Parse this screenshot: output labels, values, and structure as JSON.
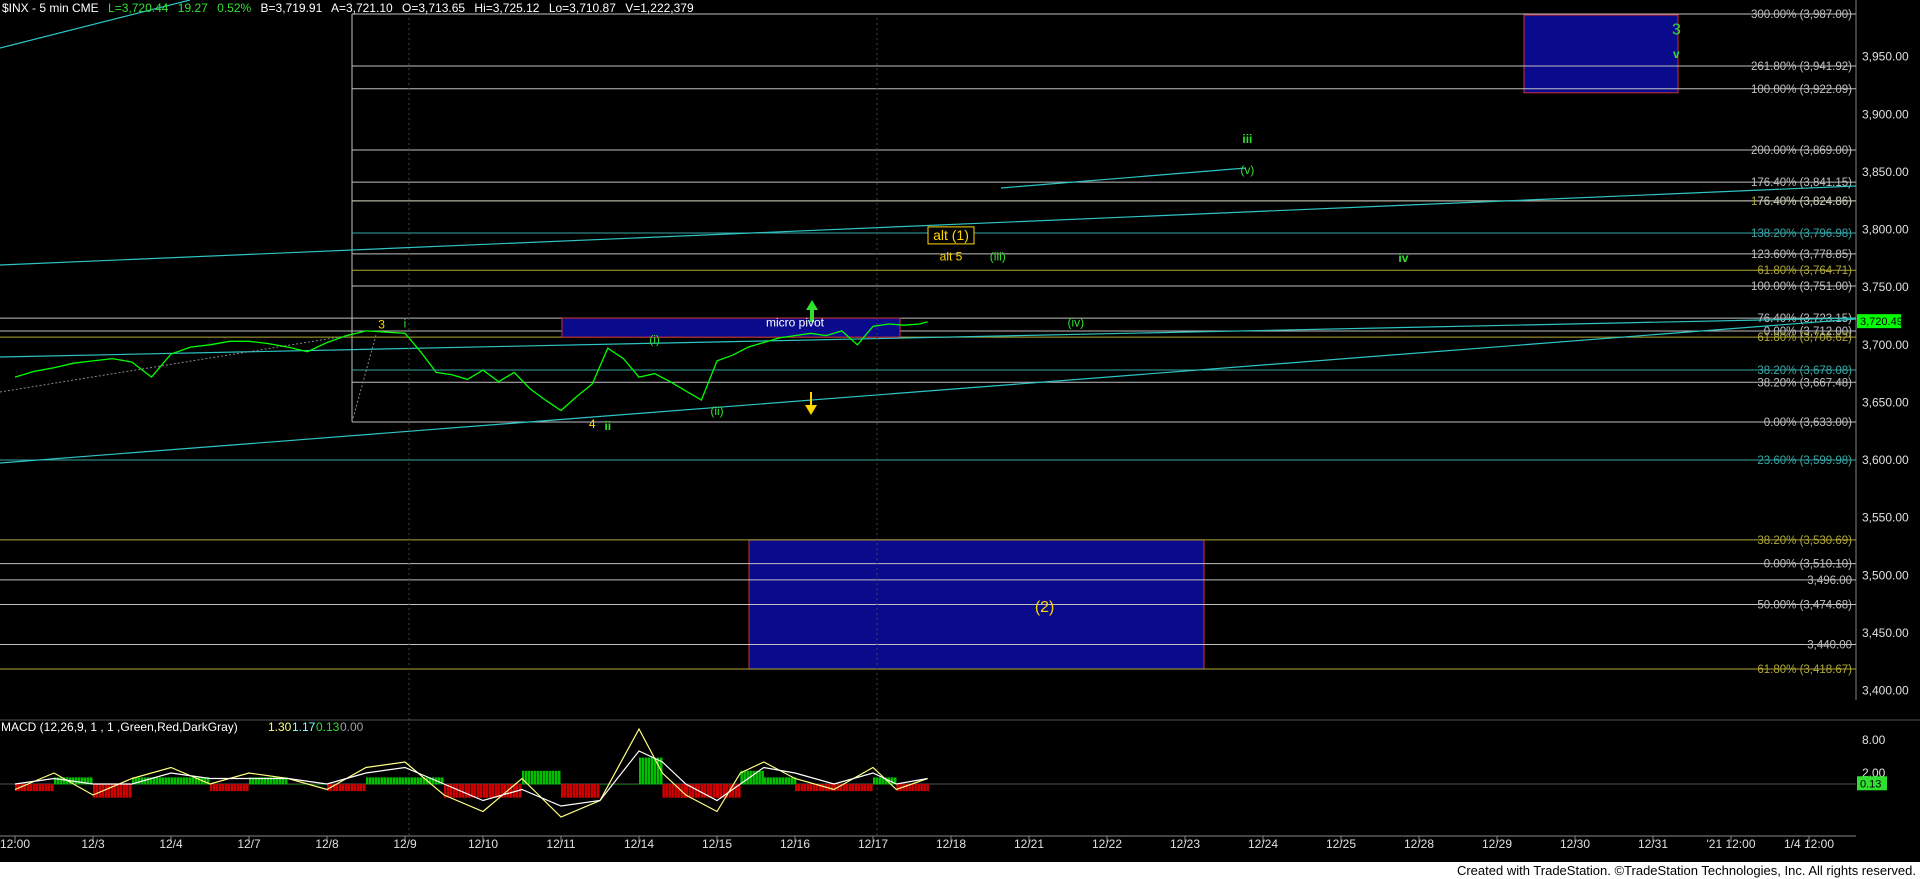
{
  "header": {
    "symbol": "$INX - 5 min CME",
    "last": "L=3,720.44",
    "change": "19.27",
    "pct": "0.52%",
    "bid": "B=3,719.91",
    "ask": "A=3,721.10",
    "open": "O=3,713.65",
    "high": "Hi=3,725.12",
    "low": "Lo=3,710.87",
    "volume": "V=1,222,379"
  },
  "colors": {
    "background": "#000000",
    "price": "#00ff00",
    "channel": "#2ec4c4",
    "fib_gray": "#c0c0c0",
    "fib_teal": "#38a8a8",
    "fib_olive": "#b0a838",
    "target_box": "#0a0a8c",
    "target_border": "#d03030",
    "yellow": "#ffd700",
    "green_label": "#30e030"
  },
  "footer": {
    "text": "Created with TradeStation. ©TradeStation Technologies, Inc. All rights reserved."
  },
  "chart_data": {
    "type": "line",
    "title": "$INX - 5 min CME",
    "xlabel": "",
    "ylabel": "",
    "ylim": [
      3370,
      3995
    ],
    "y_ticks": [
      "3,950.00",
      "3,900.00",
      "3,850.00",
      "3,800.00",
      "3,750.00",
      "3,700.00",
      "3,650.00",
      "3,600.00",
      "3,550.00",
      "3,500.00",
      "3,450.00",
      "3,400.00"
    ],
    "x_ticks": [
      "12:00",
      "12/3",
      "12/4",
      "12/7",
      "12/8",
      "12/9",
      "12/10",
      "12/11",
      "12/14",
      "12/15",
      "12/16",
      "12/17",
      "12/18",
      "12/21",
      "12/22",
      "12/23",
      "12/24",
      "12/25",
      "12/28",
      "12/29",
      "12/30",
      "12/31",
      "'21 12:00",
      "1/4 12:00"
    ],
    "last_price": "3,720.49",
    "price_series": {
      "name": "$INX",
      "x_index": [
        0,
        0.25,
        0.5,
        0.75,
        1.0,
        1.25,
        1.5,
        1.75,
        2.0,
        2.25,
        2.5,
        2.75,
        3.0,
        3.25,
        3.5,
        3.75,
        4.0,
        4.25,
        4.5,
        4.75,
        5.0,
        5.2,
        5.4,
        5.6,
        5.8,
        6.0,
        6.2,
        6.4,
        6.6,
        6.8,
        7.0,
        7.2,
        7.4,
        7.6,
        7.8,
        8.0,
        8.2,
        8.4,
        8.6,
        8.8,
        9.0,
        9.2,
        9.4,
        9.6,
        9.8,
        10.0,
        10.2,
        10.4,
        10.6,
        10.8,
        11.0,
        11.2,
        11.4,
        11.6,
        11.7
      ],
      "values": [
        3672,
        3677,
        3680,
        3684,
        3686,
        3688,
        3685,
        3672,
        3692,
        3698,
        3700,
        3703,
        3703,
        3701,
        3698,
        3694,
        3702,
        3708,
        3712,
        3711,
        3710,
        3694,
        3676,
        3674,
        3670,
        3678,
        3668,
        3676,
        3662,
        3652,
        3643,
        3655,
        3666,
        3697,
        3688,
        3672,
        3675,
        3668,
        3660,
        3652,
        3686,
        3691,
        3698,
        3702,
        3706,
        3708,
        3710,
        3708,
        3712,
        3700,
        3716,
        3718,
        3717,
        3718,
        3720
      ]
    },
    "fib_levels": [
      {
        "label": "300.00% (3,987.00)",
        "value": 3987,
        "color": "#c0c0c0"
      },
      {
        "label": "261.80% (3,941.92)",
        "value": 3941.92,
        "color": "#c0c0c0"
      },
      {
        "label": "100.00% (3,922.09)",
        "value": 3922.09,
        "color": "#c0c0c0"
      },
      {
        "label": "200.00% (3,869.00)",
        "value": 3869,
        "color": "#c0c0c0"
      },
      {
        "label": "176.40% (3,841.15)",
        "value": 3841.15,
        "color": "#c0c0c0"
      },
      {
        "label": "176.40% (3,824.86)",
        "value": 3824.86,
        "color": "#b0a838"
      },
      {
        "label": "76.40% (3,824.86)",
        "value": 3824.86,
        "color": "#c0c0c0"
      },
      {
        "label": "138.20% (3,796.98)",
        "value": 3796.98,
        "color": "#38a8a8"
      },
      {
        "label": "123.60% (3,778.85)",
        "value": 3778.85,
        "color": "#c0c0c0"
      },
      {
        "label": "61.80% (3,764.71)",
        "value": 3764.71,
        "color": "#b0a838"
      },
      {
        "label": "100.00% (3,751.00)",
        "value": 3751,
        "color": "#c0c0c0"
      },
      {
        "label": "76.40% (3,723.15)",
        "value": 3723.15,
        "color": "#c0c0c0"
      },
      {
        "label": "0.00% (3,712.00)",
        "value": 3712,
        "color": "#c0c0c0"
      },
      {
        "label": "61.80% (3,706.62)",
        "value": 3706.62,
        "color": "#b0a838"
      },
      {
        "label": "38.20% (3,678.08)",
        "value": 3678.08,
        "color": "#38a8a8"
      },
      {
        "label": "38.20% (3,667.48)",
        "value": 3667.48,
        "color": "#c0c0c0"
      },
      {
        "label": "0.00% (3,633.00)",
        "value": 3633,
        "color": "#c0c0c0"
      },
      {
        "label": "23.60% (3,599.98)",
        "value": 3599.98,
        "color": "#38a8a8"
      },
      {
        "label": "38.20% (3,530.69)",
        "value": 3530.69,
        "color": "#b0a838"
      },
      {
        "label": "0.00% (3,510.10)",
        "value": 3510.1,
        "color": "#c0c0c0"
      },
      {
        "label": "3,496.00",
        "value": 3496,
        "color": "#c0c0c0"
      },
      {
        "label": "50.00% (3,474.68)",
        "value": 3474.68,
        "color": "#c0c0c0"
      },
      {
        "label": "3,440.00",
        "value": 3440,
        "color": "#c0c0c0"
      },
      {
        "label": "61.80% (3,418.67)",
        "value": 3418.67,
        "color": "#b0a838"
      }
    ],
    "wave_labels": [
      {
        "text": "3",
        "x_index": 4.7,
        "value": 3714,
        "color": "#ffd700"
      },
      {
        "text": "i",
        "x_index": 5.0,
        "value": 3715,
        "color": "#30e030"
      },
      {
        "text": "4",
        "x_index": 7.4,
        "value": 3628,
        "color": "#ffd700"
      },
      {
        "text": "ii",
        "x_index": 7.6,
        "value": 3626,
        "color": "#30e030"
      },
      {
        "text": "(i)",
        "x_index": 8.2,
        "value": 3701,
        "color": "#30e030"
      },
      {
        "text": "(ii)",
        "x_index": 9.0,
        "value": 3639,
        "color": "#30e030"
      },
      {
        "text": "micro pivot",
        "x_index": 10.0,
        "value": 3716,
        "color": "#ffffff"
      },
      {
        "text": "alt (1)",
        "x_index": 12.0,
        "value": 3791,
        "color": "#ffd700"
      },
      {
        "text": "alt 5",
        "x_index": 12.0,
        "value": 3773,
        "color": "#ffd700"
      },
      {
        "text": "(iii)",
        "x_index": 12.6,
        "value": 3773,
        "color": "#30e030"
      },
      {
        "text": "(iv)",
        "x_index": 13.6,
        "value": 3716,
        "color": "#30e030"
      },
      {
        "text": "iii",
        "x_index": 15.8,
        "value": 3875,
        "color": "#30e030"
      },
      {
        "text": "(v)",
        "x_index": 15.8,
        "value": 3848,
        "color": "#30e030"
      },
      {
        "text": "iv",
        "x_index": 17.8,
        "value": 3772,
        "color": "#30e030"
      },
      {
        "text": "3",
        "x_index": 21.3,
        "value": 3969,
        "color": "#30e030"
      },
      {
        "text": "v",
        "x_index": 21.3,
        "value": 3949,
        "color": "#30e030"
      },
      {
        "text": "(2)",
        "x_index": 13.2,
        "value": 3468,
        "color": "#ffd700"
      }
    ],
    "macd": {
      "label": "MACD (12,26,9, 1 , 1 ,Green,Red,DarkGray)",
      "value_macd": "1.30",
      "value_signal": "1.17",
      "value_hist": "0.13",
      "value_zero": "0.00",
      "ylim": [
        -12,
        12
      ],
      "y_ticks": [
        "8.00",
        "2.00"
      ],
      "last": "0.13",
      "x_index": [
        0,
        0.5,
        1.0,
        1.5,
        2.0,
        2.5,
        3.0,
        3.5,
        4.0,
        4.5,
        5.0,
        5.5,
        6.0,
        6.5,
        7.0,
        7.5,
        8.0,
        8.3,
        8.6,
        9.0,
        9.3,
        9.6,
        10.0,
        10.5,
        11.0,
        11.3,
        11.7
      ],
      "macd_values": [
        -1,
        2,
        -2,
        1,
        3,
        0,
        2,
        1,
        -1,
        3,
        4,
        -2,
        -5,
        1,
        -6,
        -3,
        10,
        2,
        -2,
        -5,
        2,
        4,
        1,
        -1,
        3,
        -1,
        1
      ],
      "signal_values": [
        0,
        1,
        0,
        0,
        2,
        1,
        1,
        1,
        0,
        2,
        3,
        0,
        -3,
        -1,
        -4,
        -3,
        6,
        4,
        0,
        -3,
        0,
        3,
        2,
        0,
        2,
        0,
        1
      ]
    }
  }
}
